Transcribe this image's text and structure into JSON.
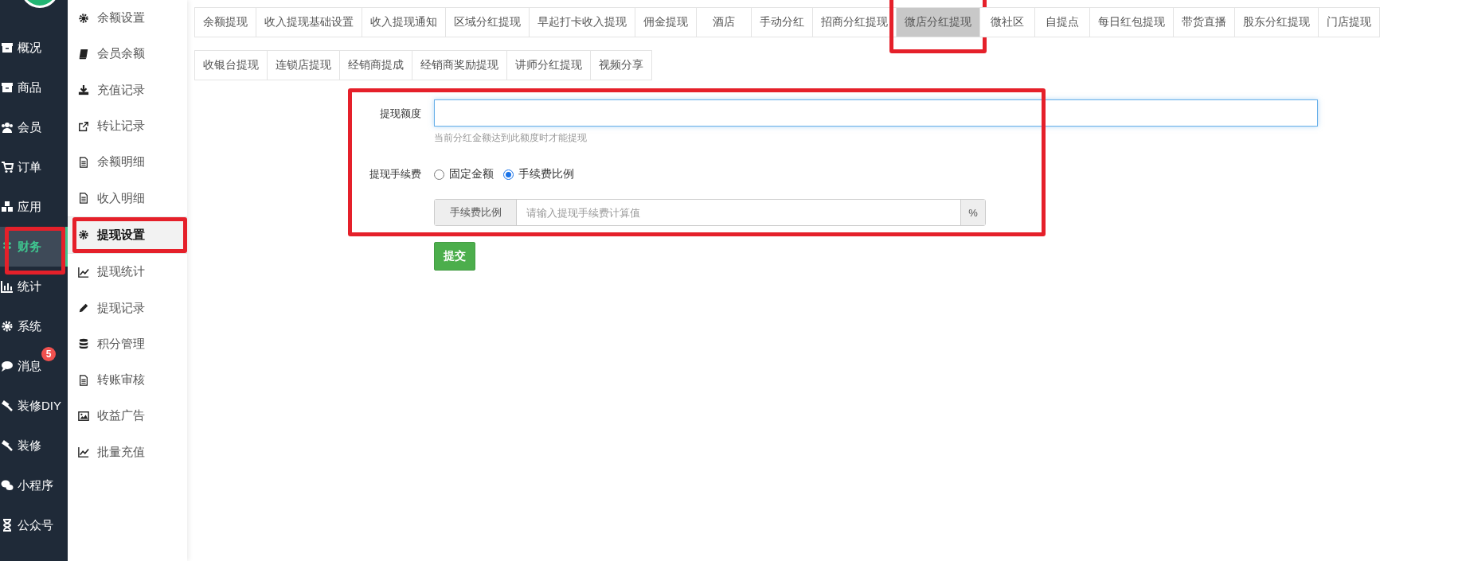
{
  "nav": [
    {
      "label": "概况",
      "selected": false
    },
    {
      "label": "商品",
      "selected": false
    },
    {
      "label": "会员",
      "selected": false
    },
    {
      "label": "订单",
      "selected": false
    },
    {
      "label": "应用",
      "selected": false
    },
    {
      "label": "财务",
      "selected": true
    },
    {
      "label": "统计",
      "selected": false
    },
    {
      "label": "系统",
      "selected": false
    },
    {
      "label": "消息",
      "selected": false,
      "badge": "5"
    },
    {
      "label": "装修DIY",
      "selected": false
    },
    {
      "label": "装修",
      "selected": false
    },
    {
      "label": "小程序",
      "selected": false
    },
    {
      "label": "公众号",
      "selected": false
    }
  ],
  "subnav": [
    {
      "label": "余额设置",
      "selected": false
    },
    {
      "label": "会员余额",
      "selected": false
    },
    {
      "label": "充值记录",
      "selected": false
    },
    {
      "label": "转让记录",
      "selected": false
    },
    {
      "label": "余额明细",
      "selected": false
    },
    {
      "label": "收入明细",
      "selected": false
    },
    {
      "label": "提现设置",
      "selected": true
    },
    {
      "label": "提现统计",
      "selected": false
    },
    {
      "label": "提现记录",
      "selected": false
    },
    {
      "label": "积分管理",
      "selected": false
    },
    {
      "label": "转账审核",
      "selected": false
    },
    {
      "label": "收益广告",
      "selected": false
    },
    {
      "label": "批量充值",
      "selected": false
    }
  ],
  "tab_rows": [
    {
      "tabs": [
        {
          "label": "余额提现",
          "selected": false
        },
        {
          "label": "收入提现基础设置",
          "selected": false
        },
        {
          "label": "收入提现通知",
          "selected": false
        },
        {
          "label": "区域分红提现",
          "selected": false
        },
        {
          "label": "早起打卡收入提现",
          "selected": false
        },
        {
          "label": "佣金提现",
          "selected": false
        },
        {
          "label": "酒店",
          "selected": false
        },
        {
          "label": "手动分红",
          "selected": false
        },
        {
          "label": "招商分红提现",
          "selected": false
        },
        {
          "label": "微店分红提现",
          "selected": true
        },
        {
          "label": "微社区",
          "selected": false
        },
        {
          "label": "自提点",
          "selected": false
        },
        {
          "label": "每日红包提现",
          "selected": false
        },
        {
          "label": "带货直播",
          "selected": false
        },
        {
          "label": "股东分红提现",
          "selected": false
        },
        {
          "label": "门店提现",
          "selected": false
        }
      ]
    },
    {
      "tabs": [
        {
          "label": "收银台提现",
          "selected": false
        },
        {
          "label": "连锁店提现",
          "selected": false
        },
        {
          "label": "经销商提成",
          "selected": false
        },
        {
          "label": "经销商奖励提现",
          "selected": false
        },
        {
          "label": "讲师分红提现",
          "selected": false
        },
        {
          "label": "视频分享",
          "selected": false
        }
      ]
    }
  ],
  "form": {
    "fields": [
      {
        "kind": "text",
        "label": "提现额度",
        "help": "当前分红金额达到此额度时才能提现"
      },
      {
        "kind": "radio",
        "label": "提现手续费",
        "options": [
          {
            "label": "固定金额",
            "selected": false
          },
          {
            "label": "手续费比例",
            "selected": true
          }
        ]
      },
      {
        "kind": "addon",
        "prefix": "手续费比例",
        "placeholder": "请输入提现手续费计算值",
        "suffix": "%"
      }
    ],
    "submit": "提交"
  }
}
